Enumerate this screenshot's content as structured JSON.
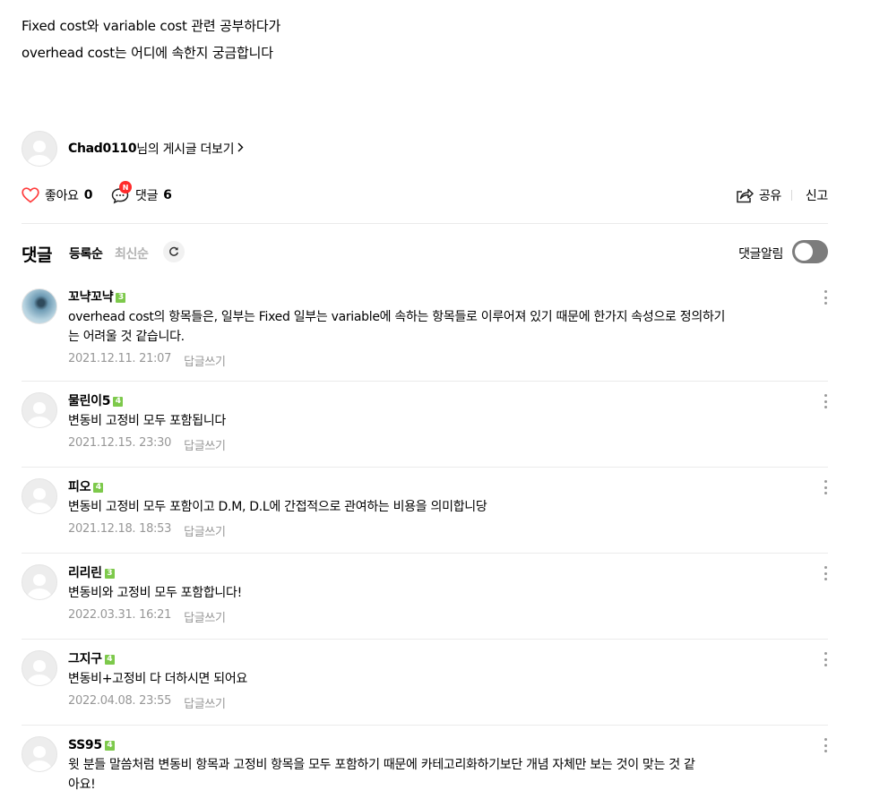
{
  "post": {
    "lines": [
      "Fixed cost와 variable cost 관련 공부하다가",
      "overhead cost는 어디에 속한지 궁금합니다"
    ]
  },
  "author": {
    "nickname": "Chad0110",
    "suffix": "님의 게시글 더보기",
    "chevron": "›"
  },
  "actions": {
    "like_label": "좋아요",
    "like_count": "0",
    "comment_label": "댓글",
    "comment_count": "6",
    "new_badge": "N",
    "share_label": "공유",
    "report_label": "신고"
  },
  "comments_header": {
    "title": "댓글",
    "sort_registered": "등록순",
    "sort_latest": "최신순",
    "alarm_label": "댓글알림",
    "alarm_on": false
  },
  "reply_label": "답글쓰기",
  "comments": [
    {
      "nickname": "꼬냑꼬냑",
      "level": "3",
      "avatar": "photo",
      "lines": [
        "overhead cost의 항목들은, 일부는 Fixed 일부는 variable에 속하는 항목들로 이루어져 있기 때문에 한가지 속성으로 정의하기",
        "는 어려울 것 같습니다."
      ],
      "date": "2021.12.11. 21:07"
    },
    {
      "nickname": "물린이5",
      "level": "4",
      "avatar": "default",
      "lines": [
        "변동비 고정비 모두 포함됩니다"
      ],
      "date": "2021.12.15. 23:30"
    },
    {
      "nickname": "피오",
      "level": "4",
      "avatar": "default",
      "lines": [
        "변동비 고정비 모두 포함이고 D.M, D.L에 간접적으로 관여하는 비용을 의미합니당"
      ],
      "date": "2021.12.18. 18:53"
    },
    {
      "nickname": "리리린",
      "level": "3",
      "avatar": "default",
      "lines": [
        "변동비와 고정비 모두 포함합니다!"
      ],
      "date": "2022.03.31. 16:21"
    },
    {
      "nickname": "그지구",
      "level": "4",
      "avatar": "default",
      "lines": [
        "변동비+고정비 다 더하시면 되어요"
      ],
      "date": "2022.04.08. 23:55"
    },
    {
      "nickname": "SS95",
      "level": "4",
      "avatar": "default",
      "lines": [
        "윗 분들 말씀처럼 변동비 항목과 고정비 항목을 모두 포함하기 때문에 카테고리화하기보단 개념 자체만 보는 것이 맞는 것 같",
        "아요!"
      ],
      "date": ""
    }
  ],
  "icons": {
    "like": "heart-outline-icon",
    "comment": "speech-bubble-icon",
    "share": "share-arrow-icon",
    "refresh": "refresh-icon",
    "more": "more-vertical-icon"
  },
  "colors": {
    "like_red": "#ff3b3b",
    "new_badge": "#ff2b2b",
    "level_badge": "#7dc94b",
    "meta_gray": "#979797",
    "sort_inactive": "#b2b2b2",
    "divider": "#ebebeb",
    "toggle_off": "#7c7c7c"
  }
}
